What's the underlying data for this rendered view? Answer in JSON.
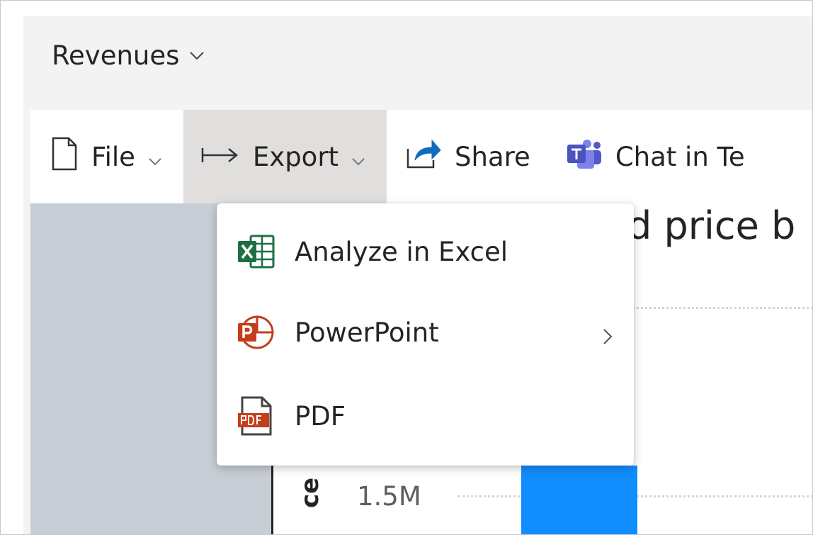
{
  "report": {
    "title": "Revenues"
  },
  "toolbar": {
    "file_label": "File",
    "export_label": "Export",
    "share_label": "Share",
    "teams_label": "Chat in Te"
  },
  "export_menu": {
    "items": [
      {
        "label": "Analyze in Excel",
        "icon": "excel-icon"
      },
      {
        "label": "PowerPoint",
        "icon": "powerpoint-icon",
        "has_submenu": true
      },
      {
        "label": "PDF",
        "icon": "pdf-icon"
      }
    ]
  },
  "visual": {
    "title_fragment": "d price b",
    "axis_tick": "1.5M",
    "axis_label_fragment": "ce"
  },
  "colors": {
    "accent_bar": "#118dff",
    "excel": "#1d7044",
    "powerpoint": "#c43e1c",
    "teams": "#5059c9",
    "share": "#0f6cbd"
  }
}
